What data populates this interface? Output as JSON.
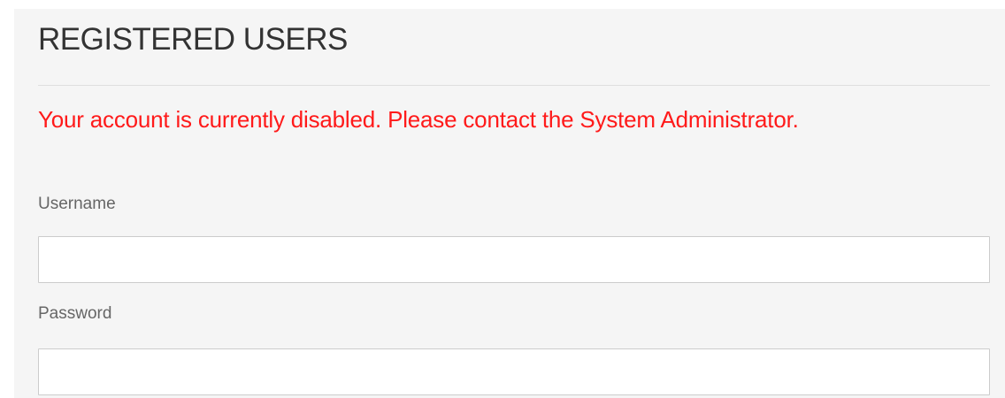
{
  "form": {
    "title": "REGISTERED USERS",
    "error_message": "Your account is currently disabled. Please contact the System Administrator.",
    "username": {
      "label": "Username",
      "value": "",
      "placeholder": ""
    },
    "password": {
      "label": "Password",
      "value": "",
      "placeholder": ""
    }
  },
  "colors": {
    "panel_background": "#f5f5f5",
    "error_text": "#ff1a1a",
    "title_text": "#333333",
    "label_text": "#666666",
    "input_border": "#cccccc"
  }
}
